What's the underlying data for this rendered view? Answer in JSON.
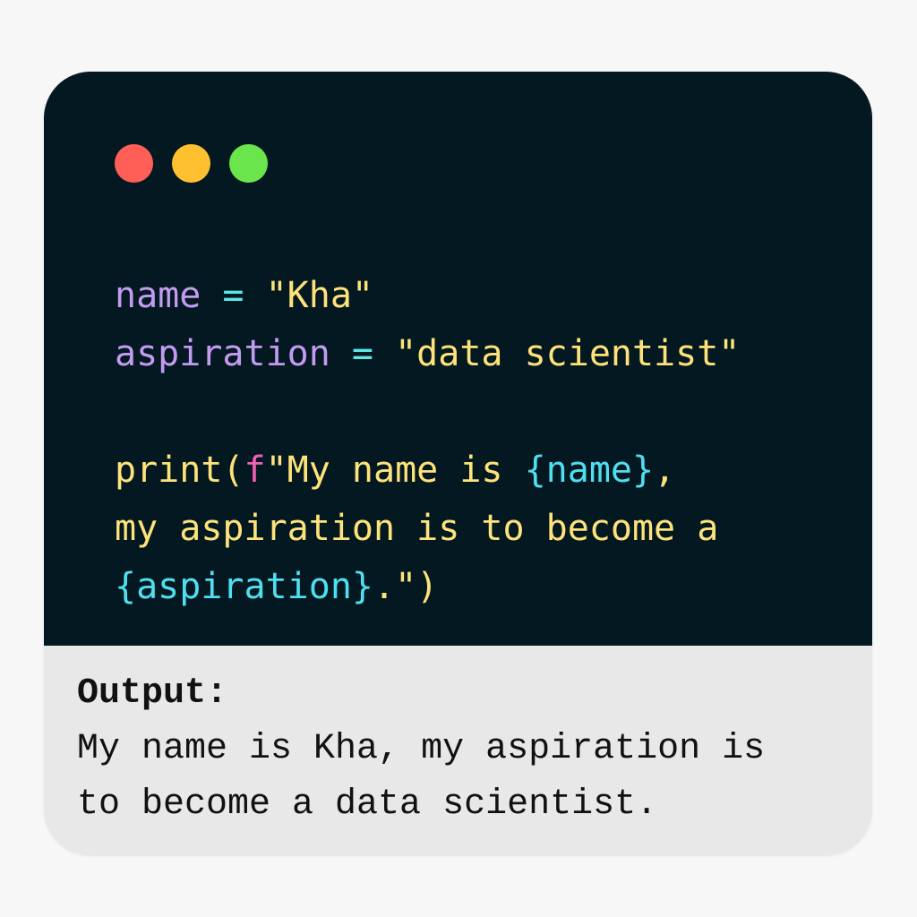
{
  "window_controls": {
    "close_color": "#ff5f57",
    "minimize_color": "#fec02f",
    "maximize_color": "#6ae54b"
  },
  "colors": {
    "editor_background": "#031820",
    "output_background": "#e8e8e8",
    "variable": "#c39bf0",
    "operator": "#5ee6e6",
    "string": "#fde37a",
    "fstring_prefix": "#f25fb8",
    "interpolation": "#4fdff0"
  },
  "code_lines": [
    [
      {
        "t": "name",
        "c": "variable"
      },
      {
        "t": " = ",
        "c": "operator"
      },
      {
        "t": "\"Kha\"",
        "c": "string"
      }
    ],
    [
      {
        "t": "aspiration",
        "c": "variable"
      },
      {
        "t": " = ",
        "c": "operator"
      },
      {
        "t": "\"data scientist\"",
        "c": "string"
      }
    ],
    [],
    [
      {
        "t": "print(",
        "c": "string"
      },
      {
        "t": "f",
        "c": "fstring_prefix"
      },
      {
        "t": "\"My name is ",
        "c": "string"
      },
      {
        "t": "{name}",
        "c": "interpolation"
      },
      {
        "t": ",",
        "c": "string"
      }
    ],
    [
      {
        "t": "my aspiration is to become a",
        "c": "string"
      }
    ],
    [
      {
        "t": "{aspiration}",
        "c": "interpolation"
      },
      {
        "t": ".\")",
        "c": "string"
      }
    ]
  ],
  "output": {
    "label": "Output:",
    "lines": [
      "My name is Kha, my aspiration is",
      "to become a data scientist."
    ]
  }
}
